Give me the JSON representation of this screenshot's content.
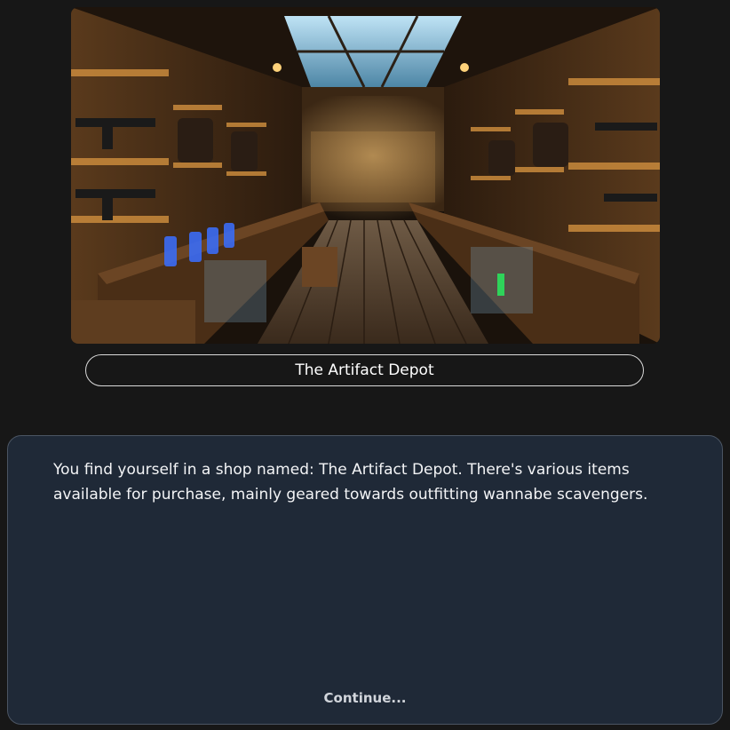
{
  "scene": {
    "image_icon": "shop-interior-illustration"
  },
  "location": {
    "name": "The Artifact Depot"
  },
  "dialog": {
    "text": "You find yourself in a shop named: The Artifact Depot. There's various items available for purchase, mainly geared towards outfitting wannabe scavengers.",
    "continue_label": "Continue..."
  },
  "colors": {
    "background": "#171717",
    "panel": "#1f2937",
    "panel_border": "#4b5563",
    "text": "#f3f4f6"
  }
}
